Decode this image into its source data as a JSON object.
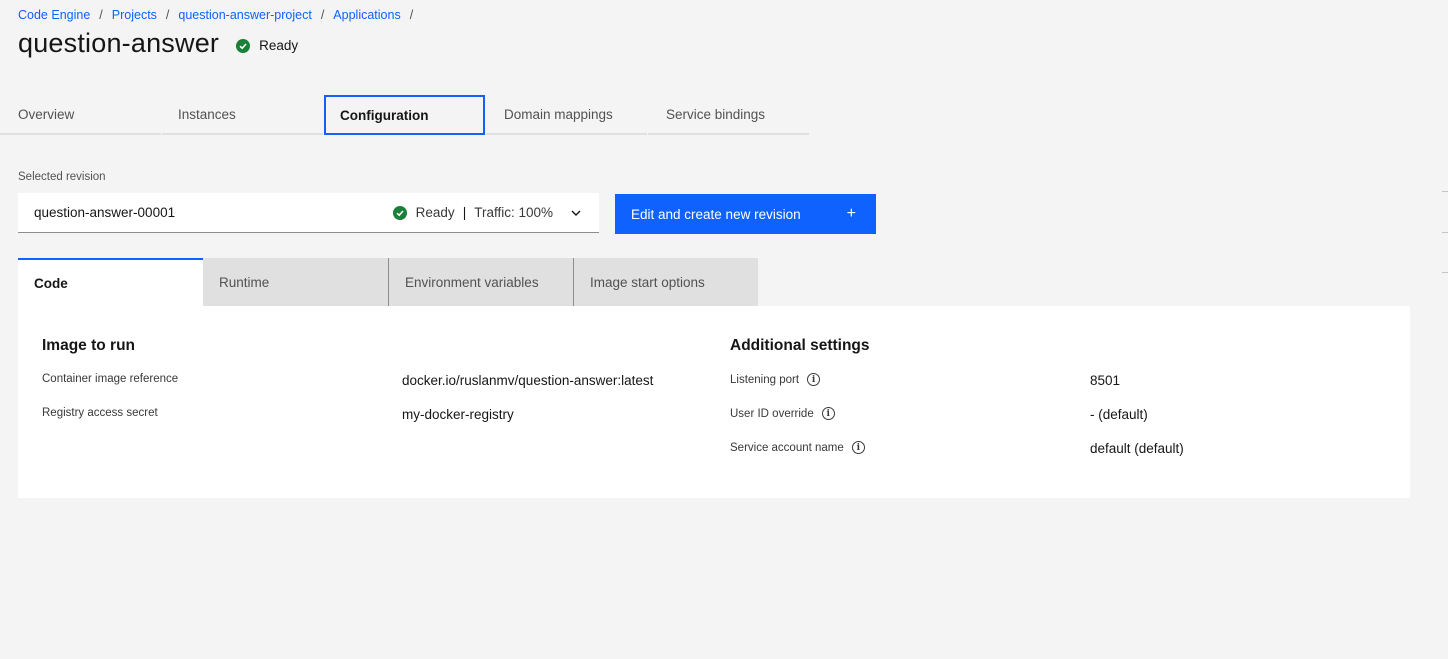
{
  "breadcrumb": [
    "Code Engine",
    "Projects",
    "question-answer-project",
    "Applications"
  ],
  "page": {
    "title": "question-answer",
    "status": "Ready"
  },
  "tabs": [
    {
      "label": "Overview",
      "active": false
    },
    {
      "label": "Instances",
      "active": false
    },
    {
      "label": "Configuration",
      "active": true
    },
    {
      "label": "Domain mappings",
      "active": false
    },
    {
      "label": "Service bindings",
      "active": false
    }
  ],
  "revision": {
    "label": "Selected revision",
    "selected": "question-answer-00001",
    "status": "Ready",
    "separator": "|",
    "traffic": "Traffic: 100%"
  },
  "actions": {
    "edit_revision": "Edit and create new revision",
    "plus": "+"
  },
  "subtabs": [
    {
      "label": "Code",
      "active": true
    },
    {
      "label": "Runtime",
      "active": false
    },
    {
      "label": "Environment variables",
      "active": false
    },
    {
      "label": "Image start options",
      "active": false
    }
  ],
  "image_to_run": {
    "title": "Image to run",
    "fields": [
      {
        "label": "Container image reference",
        "value": "docker.io/ruslanmv/question-answer:latest"
      },
      {
        "label": "Registry access secret",
        "value": "my-docker-registry"
      }
    ]
  },
  "additional_settings": {
    "title": "Additional settings",
    "fields": [
      {
        "label": "Listening port",
        "value": "8501"
      },
      {
        "label": "User ID override",
        "value": "- (default)"
      },
      {
        "label": "Service account name",
        "value": "default (default)"
      }
    ]
  },
  "colors": {
    "accent": "#0f62fe",
    "success": "#198038",
    "background": "#f4f4f4"
  },
  "icons": {
    "status": "checkmark-filled-icon",
    "dropdown": "chevron-down-icon",
    "info": "information-icon",
    "add": "add-icon"
  }
}
